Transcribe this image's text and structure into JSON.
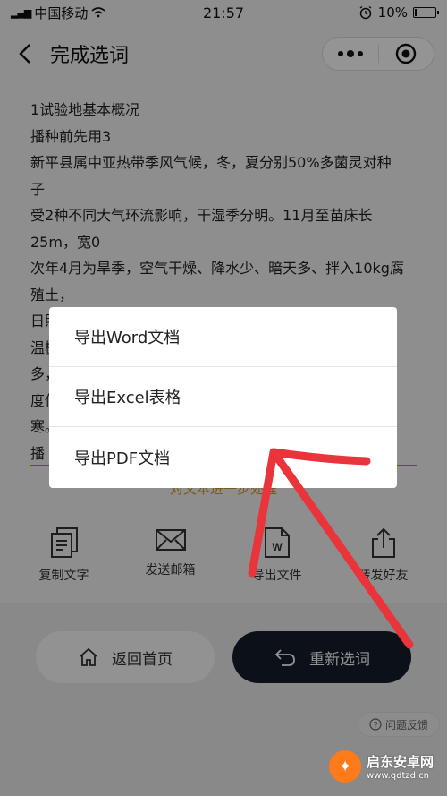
{
  "status_bar": {
    "carrier": "中国移动",
    "time": "21:57",
    "battery_percent": "10%",
    "battery_level": 0.1
  },
  "nav": {
    "title": "完成选词"
  },
  "document": {
    "lines": [
      "1试验地基本概况",
      "播种前先用3",
      "新平县属中亚热带季风气候，冬，夏分别50%多菌灵对种",
      "子",
      "受2种不同大气环流影响，干湿季分明。11月至苗床长",
      "25m，宽0",
      "次年4月为旱季，空气干燥、降水少、暗天多、拌入10kg腐",
      "殖土，",
      "日照强，昼夜温差大，且至10月为雨季，降水消毒，如小",
      "温棚",
      "多，",
      "度低",
      "寒。",
      "播"
    ],
    "process_link": "对文本进一步处理"
  },
  "actions": [
    {
      "label": "复制文字",
      "icon": "copy-icon"
    },
    {
      "label": "发送邮箱",
      "icon": "mail-icon"
    },
    {
      "label": "导出文件",
      "icon": "word-file-icon"
    },
    {
      "label": "转发好友",
      "icon": "share-icon"
    }
  ],
  "buttons": {
    "home_label": "返回首页",
    "reselect_label": "重新选词"
  },
  "feedback_label": "问题反馈",
  "export_menu": {
    "items": [
      "导出Word文档",
      "导出Excel表格",
      "导出PDF文档"
    ]
  },
  "watermark": {
    "name": "启东安卓网",
    "url": "www.qdtzd.cn"
  },
  "colors": {
    "accent_orange": "#d79a2b",
    "dark_button": "#161d2a",
    "annotation_red": "#e8343a"
  }
}
